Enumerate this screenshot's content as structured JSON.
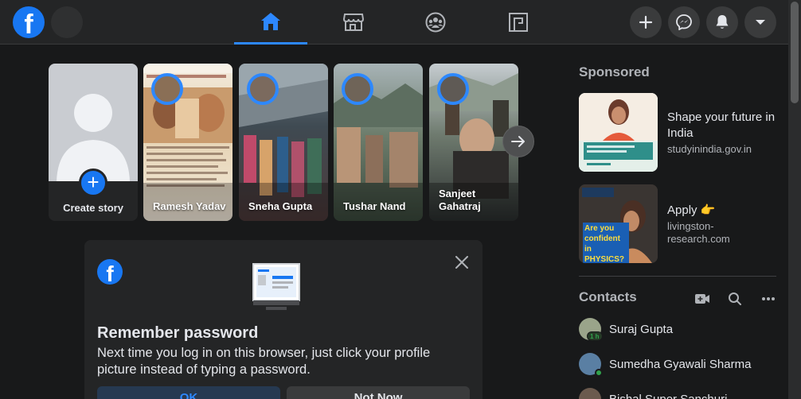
{
  "nav": {
    "logo_letter": "f",
    "tabs": [
      {
        "name": "home",
        "active": true
      },
      {
        "name": "marketplace",
        "active": false
      },
      {
        "name": "groups",
        "active": false
      },
      {
        "name": "gaming",
        "active": false
      }
    ],
    "accent_color": "#2d88ff"
  },
  "stories": {
    "create_label": "Create story",
    "items": [
      {
        "name": "Ramesh Yadav"
      },
      {
        "name": "Sneha Gupta"
      },
      {
        "name": "Tushar Nand"
      },
      {
        "name": "Sanjeet Gahatraj"
      }
    ]
  },
  "remember_password": {
    "logo_letter": "f",
    "title": "Remember password",
    "text": "Next time you log in on this browser, just click your profile picture instead of typing a password.",
    "ok_label": "OK",
    "not_now_label": "Not Now"
  },
  "sponsored": {
    "title": "Sponsored",
    "ads": [
      {
        "title": "Shape your future in India",
        "url": "studyinindia.gov.in"
      },
      {
        "title": "Apply 👉",
        "url": "livingston-research.com",
        "image_text": "Are you confident in PHYSICS?"
      }
    ]
  },
  "contacts": {
    "title": "Contacts",
    "items": [
      {
        "name": "Suraj Gupta",
        "badge": "1 h"
      },
      {
        "name": "Sumedha Gyawali Sharma",
        "online": true
      },
      {
        "name": "Bishal Super Sanchuri"
      }
    ]
  }
}
